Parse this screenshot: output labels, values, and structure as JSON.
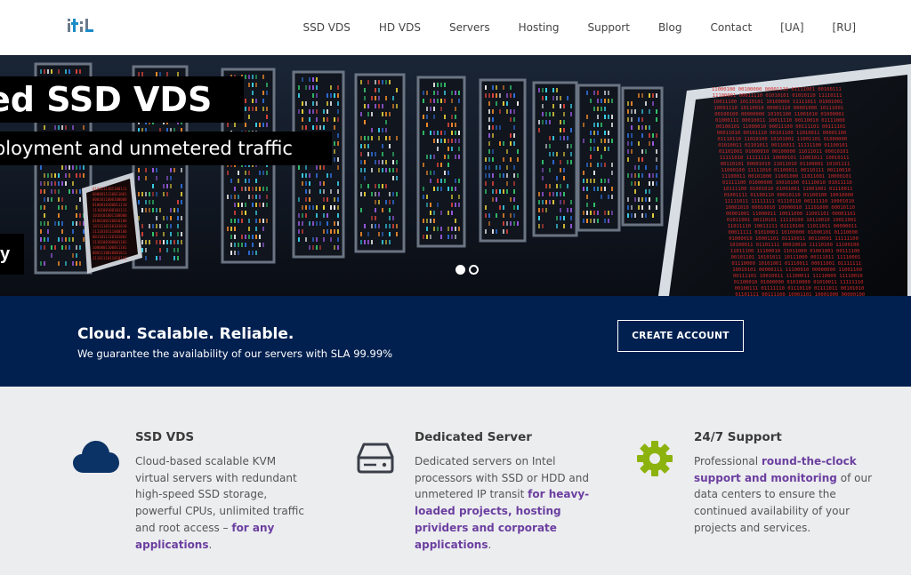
{
  "nav": {
    "logo_icon": "itl-logo",
    "items": [
      {
        "label": "SSD VDS"
      },
      {
        "label": "HD VDS"
      },
      {
        "label": "Servers"
      },
      {
        "label": "Hosting"
      },
      {
        "label": "Support"
      },
      {
        "label": "Blog"
      },
      {
        "label": "Contact"
      },
      {
        "label": "[UA]"
      },
      {
        "label": "[RU]"
      }
    ]
  },
  "hero": {
    "title": "ed SSD VDS",
    "subtitle": "eployment and unmetered traffic",
    "button_label": "y",
    "slide_count": 2,
    "active_slide": 1
  },
  "banner": {
    "title": "Cloud. Scalable. Reliable.",
    "subtitle": "We guarantee the availability of our servers with SLA 99.99%",
    "button_label": "CREATE ACCOUNT"
  },
  "features": [
    {
      "icon": "cloud-icon",
      "title": "SSD VDS",
      "text": "Cloud-based scalable KVM virtual servers with redundant high-speed SSD storage, powerful CPUs, unlimited traffic and root access –",
      "highlight": "for any applications",
      "tail": "."
    },
    {
      "icon": "hard-drive-icon",
      "title": "Dedicated Server",
      "text": "Dedicated servers on Intel processors with SSD or HDD and unmetered IP transit",
      "highlight": "for heavy-loaded projects, hosting prividers and corporate applications",
      "tail": "."
    },
    {
      "icon": "gear-icon",
      "title": "24/7 Support",
      "pre": "Professional",
      "highlight": "round-the-clock support and monitoring",
      "text": "of our data centers to ensure the continued availability of your projects and services."
    }
  ],
  "colors": {
    "banner_bg": "#012050",
    "features_bg": "#ecedef",
    "highlight": "#6b3fa0",
    "cloud_icon": "#0c3366",
    "gear_icon": "#8cb30d"
  }
}
